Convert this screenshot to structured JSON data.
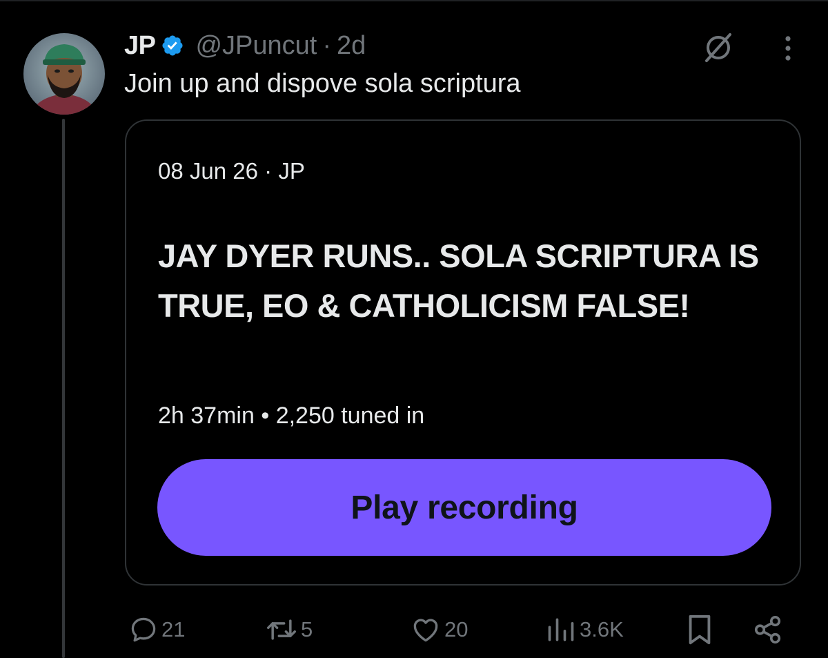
{
  "author": {
    "display_name": "JP",
    "handle": "@JPuncut",
    "separator": "·",
    "time": "2d",
    "verified_color": "#1d9bf0"
  },
  "tweet": {
    "text": "Join up and dispove sola scriptura"
  },
  "space_card": {
    "date": "08 Jun 26",
    "meta_separator": "·",
    "host": "JP",
    "title": "JAY DYER RUNS.. SOLA SCRIPTURA IS TRUE, EO & CATHOLICISM FALSE!",
    "duration": "2h 37min",
    "stats_separator": "•",
    "listeners": "2,250 tuned in",
    "play_label": "Play recording",
    "accent_color": "#7856ff"
  },
  "actions": {
    "replies": "21",
    "reposts": "5",
    "likes": "20",
    "views": "3.6K"
  },
  "icons": {
    "avatar": "avatar-illustration",
    "verified": "verified-badge-icon",
    "grok": "grok-icon",
    "more": "more-vertical-icon",
    "reply": "reply-icon",
    "repost": "repost-icon",
    "like": "heart-icon",
    "views": "views-chart-icon",
    "bookmark": "bookmark-icon",
    "share": "share-icon"
  },
  "colors": {
    "background": "#000000",
    "text_primary": "#e7e9ea",
    "text_secondary": "#71767b",
    "border": "#2f3336"
  }
}
